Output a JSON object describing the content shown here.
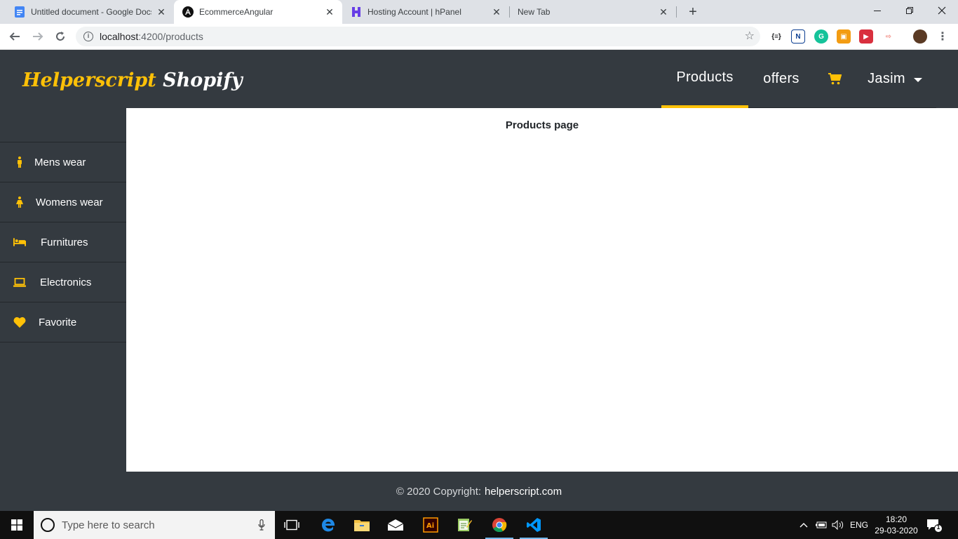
{
  "browser": {
    "tabs": [
      {
        "title": "Untitled document - Google Docs",
        "icon": "docs-icon"
      },
      {
        "title": "EcommerceAngular",
        "icon": "angular-icon",
        "active": true
      },
      {
        "title": "Hosting Account | hPanel",
        "icon": "hostinger-icon"
      },
      {
        "title": "New Tab",
        "icon": ""
      }
    ],
    "url_host": "localhost",
    "url_path": ":4200/products"
  },
  "header": {
    "brand_part1": "Helperscript",
    "brand_part2": "Shopify",
    "nav": {
      "products": "Products",
      "offers": "offers",
      "user": "Jasim"
    }
  },
  "sidebar": {
    "items": [
      {
        "label": "Mens wear",
        "icon": "male-icon"
      },
      {
        "label": "Womens wear",
        "icon": "female-icon"
      },
      {
        "label": "Furnitures",
        "icon": "bed-icon"
      },
      {
        "label": "Electronics",
        "icon": "laptop-icon"
      },
      {
        "label": "Favorite",
        "icon": "heart-icon"
      }
    ]
  },
  "main": {
    "title": "Products page"
  },
  "footer": {
    "copyright": "© 2020 Copyright:",
    "link": "helperscript.com"
  },
  "taskbar": {
    "search_placeholder": "Type here to search",
    "language": "ENG",
    "time": "18:20",
    "date": "29-03-2020",
    "notification_count": "1"
  },
  "colors": {
    "dark": "#343a40",
    "accent": "#ffc107"
  }
}
